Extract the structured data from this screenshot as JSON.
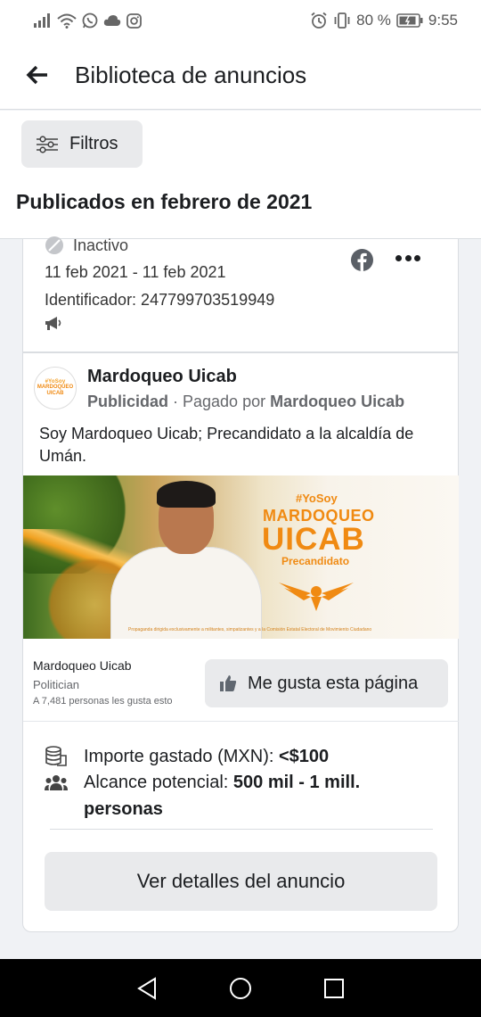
{
  "status_bar": {
    "battery_text": "80 %",
    "time": "9:55",
    "icons_left": [
      "signal-icon",
      "wifi-icon",
      "whatsapp-icon",
      "cloud-icon",
      "instagram-icon"
    ],
    "icons_right": [
      "alarm-icon",
      "vibrate-icon",
      "battery-icon"
    ]
  },
  "header": {
    "title": "Biblioteca de anuncios",
    "back_icon": "back-arrow-icon"
  },
  "filters": {
    "label": "Filtros",
    "icon": "filter-sliders-icon"
  },
  "section": {
    "title": "Publicados en febrero de 2021"
  },
  "ad_meta": {
    "status": "Inactivo",
    "date_range": "11 feb 2021 - 11 feb 2021",
    "identifier": "Identificador: 247799703519949",
    "platform_icon": "facebook-icon",
    "more_icon": "more-dots-icon",
    "megaphone_icon": "megaphone-icon"
  },
  "ad": {
    "avatar": {
      "top": "#YoSoy",
      "main": "MARDOQUEO UICAB",
      "sub": "Precandidato"
    },
    "advertiser": "Mardoqueo Uicab",
    "sponsor_label": "Publicidad",
    "sponsor_sep": " · Pagado por ",
    "sponsor_name": "Mardoqueo Uicab",
    "body": "Soy Mardoqueo Uicab; Precandidato a la alcaldía de Umán.",
    "creative": {
      "hashtag": "#YoSoy",
      "name_line1": "MARDOQUEO",
      "name_line2": "UICAB",
      "role": "Precandidato",
      "disclaimer": "Propaganda dirigida exclusivamente a militantes, simpatizantes y a la Comisión Estatal Electoral de Movimiento Ciudadano"
    },
    "page_name": "Mardoqueo Uicab",
    "page_category": "Politician",
    "page_likes": "A 7,481 personas les gusta esto",
    "like_button": "Me gusta esta página",
    "like_icon": "thumbs-up-icon"
  },
  "stats": {
    "spend_label": "Importe gastado (MXN): ",
    "spend_value": "<$100",
    "reach_label": "Alcance potencial: ",
    "reach_value": "500 mil - 1 mill. personas",
    "spend_icon": "coins-stack-icon",
    "reach_icon": "people-icon"
  },
  "details_button": "Ver detalles del anuncio",
  "nav": {
    "back": "nav-back-icon",
    "home": "nav-home-icon",
    "recents": "nav-recents-icon"
  }
}
